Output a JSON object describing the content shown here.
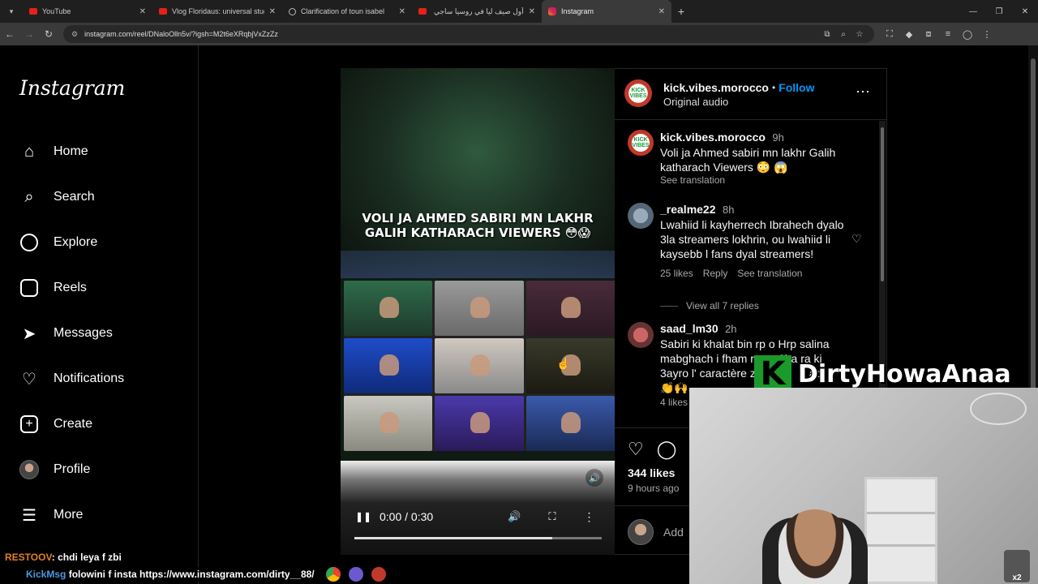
{
  "browser": {
    "tabs": [
      {
        "title": "YouTube",
        "icon": "youtube-icon"
      },
      {
        "title": "Vlog Floridaus: universal studio",
        "icon": "youtube-icon"
      },
      {
        "title": "Clarification of toun isabel",
        "icon": "globe-icon"
      },
      {
        "title": "أول صيف ليا في روسيا ساجي دو",
        "icon": "youtube-icon"
      },
      {
        "title": "Instagram",
        "icon": "instagram-icon"
      }
    ],
    "url": "instagram.com/reel/DNaloOlln5v/?igsh=M2t6eXRqbjVxZzZz"
  },
  "sidebar": {
    "logo": "Instagram",
    "items": [
      {
        "label": "Home",
        "icon": "home-icon"
      },
      {
        "label": "Search",
        "icon": "search-icon"
      },
      {
        "label": "Explore",
        "icon": "explore-icon"
      },
      {
        "label": "Reels",
        "icon": "reels-icon"
      },
      {
        "label": "Messages",
        "icon": "messages-icon"
      },
      {
        "label": "Notifications",
        "icon": "heart-icon"
      },
      {
        "label": "Create",
        "icon": "plus-icon"
      },
      {
        "label": "Profile",
        "icon": "avatar"
      },
      {
        "label": "More",
        "icon": "menu-icon"
      }
    ]
  },
  "video": {
    "caption_line1": "VOLI JA AHMED SABIRI MN LAKHR",
    "caption_line2": "GALIH KATHARACH VIEWERS 😳😱",
    "time": "0:00 / 0:30",
    "progress": 0.8
  },
  "post": {
    "username": "kick.vibes.morocco",
    "separator": "•",
    "follow": "Follow",
    "audio": "Original audio",
    "avatar_text": "KICK VIBES",
    "caption": {
      "user": "kick.vibes.morocco",
      "time": "9h",
      "text": "Voli ja Ahmed sabiri mn lakhr Galih katharach Viewers 😳 😱",
      "translate": "See translation"
    },
    "comments": [
      {
        "user": "_realme22",
        "time": "8h",
        "text": "Lwahiid li kayherrech Ibrahech dyalo 3la streamers lokhrin, ou lwahiid li kaysebb l fans dyal streamers!",
        "likes": "25 likes",
        "reply": "Reply",
        "translate": "See translation",
        "view_replies": "View all 7 replies"
      },
      {
        "user": "saad_lm30",
        "time": "2h",
        "text_line1": "Sabiri ki khalat bin rp o Hrp salina",
        "text_line2": "mabghach i fham r",
        "text_line2b": "3ba ra ki",
        "text_line3": "3ayro l' caractère z",
        "text_line3b": "ac",
        "emojis": "👏🙌",
        "likes": "4 likes"
      }
    ],
    "likes": "344 likes",
    "ago": "9 hours ago",
    "add_comment": "Add"
  },
  "overlay": {
    "banner": "DirtyHowaAnaa",
    "chat_name": "RESTOOV",
    "chat_text": ": chdi leya f zbi",
    "ticker_name": "KickMsg",
    "ticker_text": " folowini f insta https://www.instagram.com/dirty__88/",
    "badge": "x2"
  },
  "colors": {
    "accent": "#0095f6",
    "kick": "#1a9a2a",
    "bg": "#000000"
  }
}
